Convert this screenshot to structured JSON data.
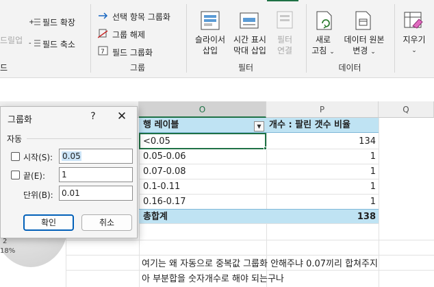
{
  "ribbon": {
    "outline_group": {
      "partial_left_label": "드릴업",
      "expand_field": "필드 확장",
      "collapse_field": "필드 축소",
      "partial_group_label": "드"
    },
    "group_group": {
      "group_selection": "선택 항목 그룹화",
      "ungroup": "그룹 해제",
      "group_field": "필드 그룹화",
      "label": "그룹"
    },
    "filter_group": {
      "slicer_line1": "슬라이서",
      "slicer_line2": "삽입",
      "timeline_line1": "시간 표시",
      "timeline_line2": "막대 삽입",
      "filter_conn_line1": "필터",
      "filter_conn_line2": "연결",
      "label": "필터"
    },
    "data_group": {
      "refresh_line1": "새로",
      "refresh_line2": "고침",
      "change_source_line1": "데이터 원본",
      "change_source_line2": "변경",
      "label": "데이터"
    },
    "actions_group": {
      "clear_line1": "지우기"
    }
  },
  "sheet": {
    "col_o": "O",
    "col_p": "P",
    "col_q": "Q",
    "pivot": {
      "row_label_header": "행 레이블",
      "value_header": "개수 : 팔린 갯수 비율",
      "rows": [
        {
          "label": "<0.05",
          "value": "134"
        },
        {
          "label": "0.05-0.06",
          "value": "1"
        },
        {
          "label": "0.07-0.08",
          "value": "1"
        },
        {
          "label": "0.1-0.11",
          "value": "1"
        },
        {
          "label": "0.16-0.17",
          "value": "1"
        }
      ],
      "total_label": "총합계",
      "total_value": "138"
    },
    "notes": [
      "여기는 왜 자동으로 중복값 그룹화 안해주냐 0.07끼리 합쳐주지",
      "아 부분합을 숫자개수로 해야 되는구나"
    ],
    "chart_partial": {
      "label1": "2",
      "label2": "18%"
    }
  },
  "dialog": {
    "title": "그룹화",
    "help": "?",
    "close": "✕",
    "section": "자동",
    "start_label": "시작(S):",
    "start_value": "0.05",
    "end_label": "끝(E):",
    "end_value": "1",
    "step_label": "단위(B):",
    "step_value": "0.01",
    "ok": "확인",
    "cancel": "취소"
  }
}
